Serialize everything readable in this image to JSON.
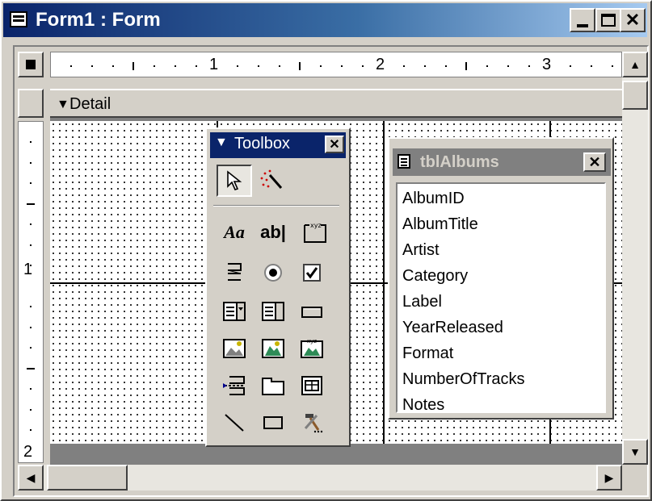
{
  "window": {
    "title": "Form1 : Form",
    "minimize": "",
    "maximize": "",
    "close": "✕"
  },
  "ruler": {
    "h_labels": [
      "1",
      "2",
      "3"
    ],
    "v_labels": [
      "1",
      "2"
    ]
  },
  "section": {
    "label": "Detail",
    "arrow": "▼"
  },
  "toolbox": {
    "title": "Toolbox",
    "close": "✕",
    "tools": [
      {
        "name": "select-objects-tool",
        "glyph": "⇱"
      },
      {
        "name": "control-wizards-tool",
        "glyph": "✎"
      },
      {
        "name": "label-tool",
        "glyph": "Aa"
      },
      {
        "name": "text-box-tool",
        "glyph": "ab|"
      },
      {
        "name": "option-group-tool",
        "glyph": "xyz"
      },
      {
        "name": "toggle-button-tool",
        "glyph": "≡"
      },
      {
        "name": "option-button-tool",
        "glyph": "◉"
      },
      {
        "name": "check-box-tool",
        "glyph": "☑"
      },
      {
        "name": "combo-box-tool",
        "glyph": "▤"
      },
      {
        "name": "list-box-tool",
        "glyph": "▥"
      },
      {
        "name": "command-button-tool",
        "glyph": "▭"
      },
      {
        "name": "image-tool",
        "glyph": "▨"
      },
      {
        "name": "unbound-object-frame-tool",
        "glyph": "▦"
      },
      {
        "name": "bound-object-frame-tool",
        "glyph": "▩"
      },
      {
        "name": "page-break-tool",
        "glyph": "☰"
      },
      {
        "name": "tab-control-tool",
        "glyph": "⊓"
      },
      {
        "name": "subform-tool",
        "glyph": "▣"
      },
      {
        "name": "line-tool",
        "glyph": "╲"
      },
      {
        "name": "rectangle-tool",
        "glyph": "▭"
      },
      {
        "name": "more-controls-tool",
        "glyph": "⚒"
      }
    ]
  },
  "fieldlist": {
    "title": "tblAlbums",
    "close": "✕",
    "fields": [
      "AlbumID",
      "AlbumTitle",
      "Artist",
      "Category",
      "Label",
      "YearReleased",
      "Format",
      "NumberOfTracks",
      "Notes"
    ]
  },
  "scroll": {
    "up": "▲",
    "down": "▼",
    "left": "◀",
    "right": "▶"
  },
  "colors": {
    "titlebar_active": "#0a246a",
    "titlebar_inactive": "#808080",
    "face": "#d4d0c8"
  }
}
